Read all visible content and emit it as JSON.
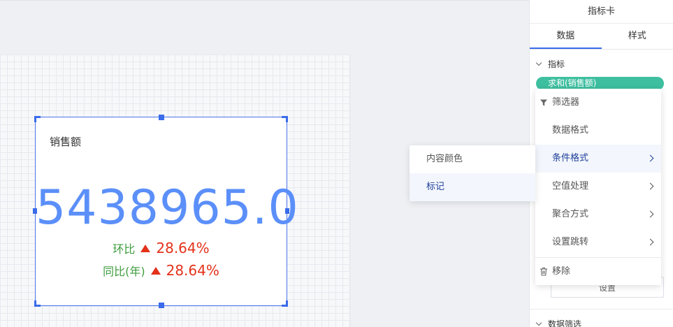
{
  "card": {
    "title": "销售额",
    "value": "5438965.0",
    "mom_label": "环比",
    "mom_value": "28.64%",
    "yoy_label": "同比(年)",
    "yoy_value": "28.64%"
  },
  "panel": {
    "title": "指标卡",
    "tabs": [
      "数据",
      "样式"
    ],
    "active_tab": "数据",
    "metric_section": "指标",
    "metric_pill": "求和(销售额)",
    "setting_button": "设置",
    "filter_section": "数据筛选"
  },
  "menu": {
    "filter": "筛选器",
    "data_format": "数据格式",
    "conditional_format": "条件格式",
    "null_handling": "空值处理",
    "aggregation": "聚合方式",
    "jump": "设置跳转",
    "remove": "移除"
  },
  "submenu": {
    "content_color": "内容颜色",
    "marker": "标记"
  },
  "colors": {
    "accent": "#3a6bea",
    "value_blue": "#5b8ff9",
    "label_green": "#3c9c3c",
    "up_red": "#e3311a",
    "pill_green": "#3ebfa0"
  }
}
